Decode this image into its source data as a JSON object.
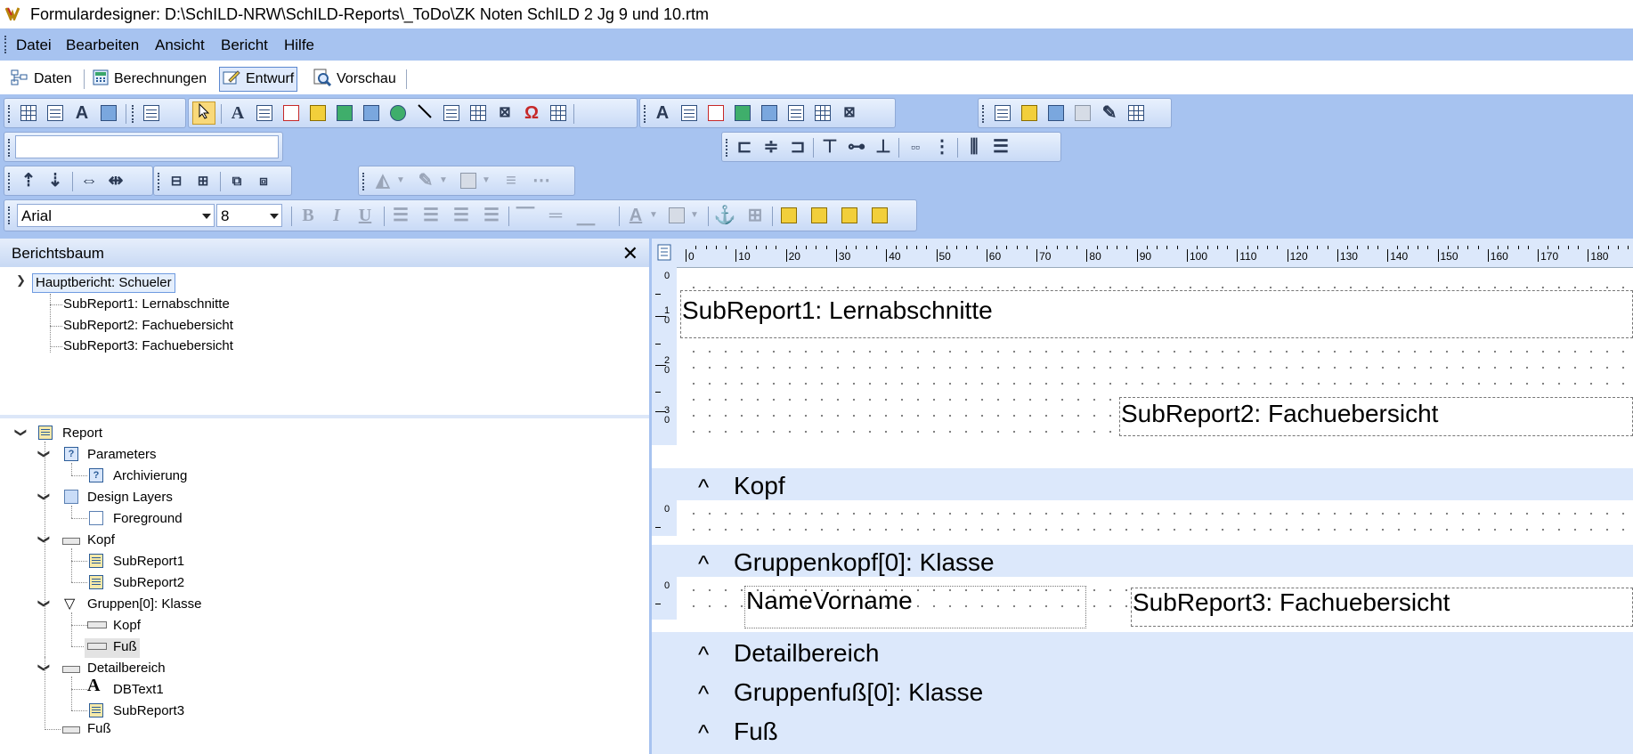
{
  "window": {
    "title": "Formulardesigner: D:\\SchILD-NRW\\SchILD-Reports\\_ToDo\\ZK Noten SchILD 2 Jg 9 und 10.rtm"
  },
  "menu": {
    "items": [
      "Datei",
      "Bearbeiten",
      "Ansicht",
      "Bericht",
      "Hilfe"
    ]
  },
  "tabs": [
    {
      "label": "Daten"
    },
    {
      "label": "Berechnungen"
    },
    {
      "label": "Entwurf"
    },
    {
      "label": "Vorschau"
    }
  ],
  "format_toolbar": {
    "font_name": "Arial",
    "font_size": "8"
  },
  "panel": {
    "title": "Berichtsbaum",
    "close_glyph": "✕",
    "report_tree": {
      "root": "Hauptbericht: Schueler",
      "children": [
        "SubReport1: Lernabschnitte",
        "SubReport2: Fachuebersicht",
        "SubReport3: Fachuebersicht"
      ]
    },
    "object_tree": {
      "report": "Report",
      "parameters": "Parameters",
      "archivierung": "Archivierung",
      "design_layers": "Design Layers",
      "foreground": "Foreground",
      "kopf": "Kopf",
      "subreport1": "SubReport1",
      "subreport2": "SubReport2",
      "gruppen": "Gruppen[0]: Klasse",
      "gruppen_kopf": "Kopf",
      "gruppen_fuss": "Fuß",
      "detailbereich": "Detailbereich",
      "dbtext1": "DBText1",
      "subreport3": "SubReport3",
      "fuss": "Fuß"
    }
  },
  "ruler": {
    "top_labels": [
      "0",
      "10",
      "20",
      "30",
      "40",
      "50",
      "60",
      "70",
      "80",
      "90",
      "100",
      "110",
      "120",
      "130",
      "140",
      "150",
      "160",
      "170",
      "180"
    ],
    "left_labels_top": [
      "0",
      "1\n0",
      "2\n0",
      "3\n0"
    ]
  },
  "design": {
    "caret": "^",
    "subreport1": "SubReport1: Lernabschnitte",
    "subreport2": "SubReport2: Fachuebersicht",
    "band_kopf": "Kopf",
    "band_gruppenkopf": "Gruppenkopf[0]: Klasse",
    "namevorname": "NameVorname",
    "subreport3": "SubReport3: Fachuebersicht",
    "band_detail": "Detailbereich",
    "band_gruppenfuss": "Gruppenfuß[0]: Klasse",
    "band_fuss": "Fuß",
    "band_ruler_zero": "0"
  }
}
